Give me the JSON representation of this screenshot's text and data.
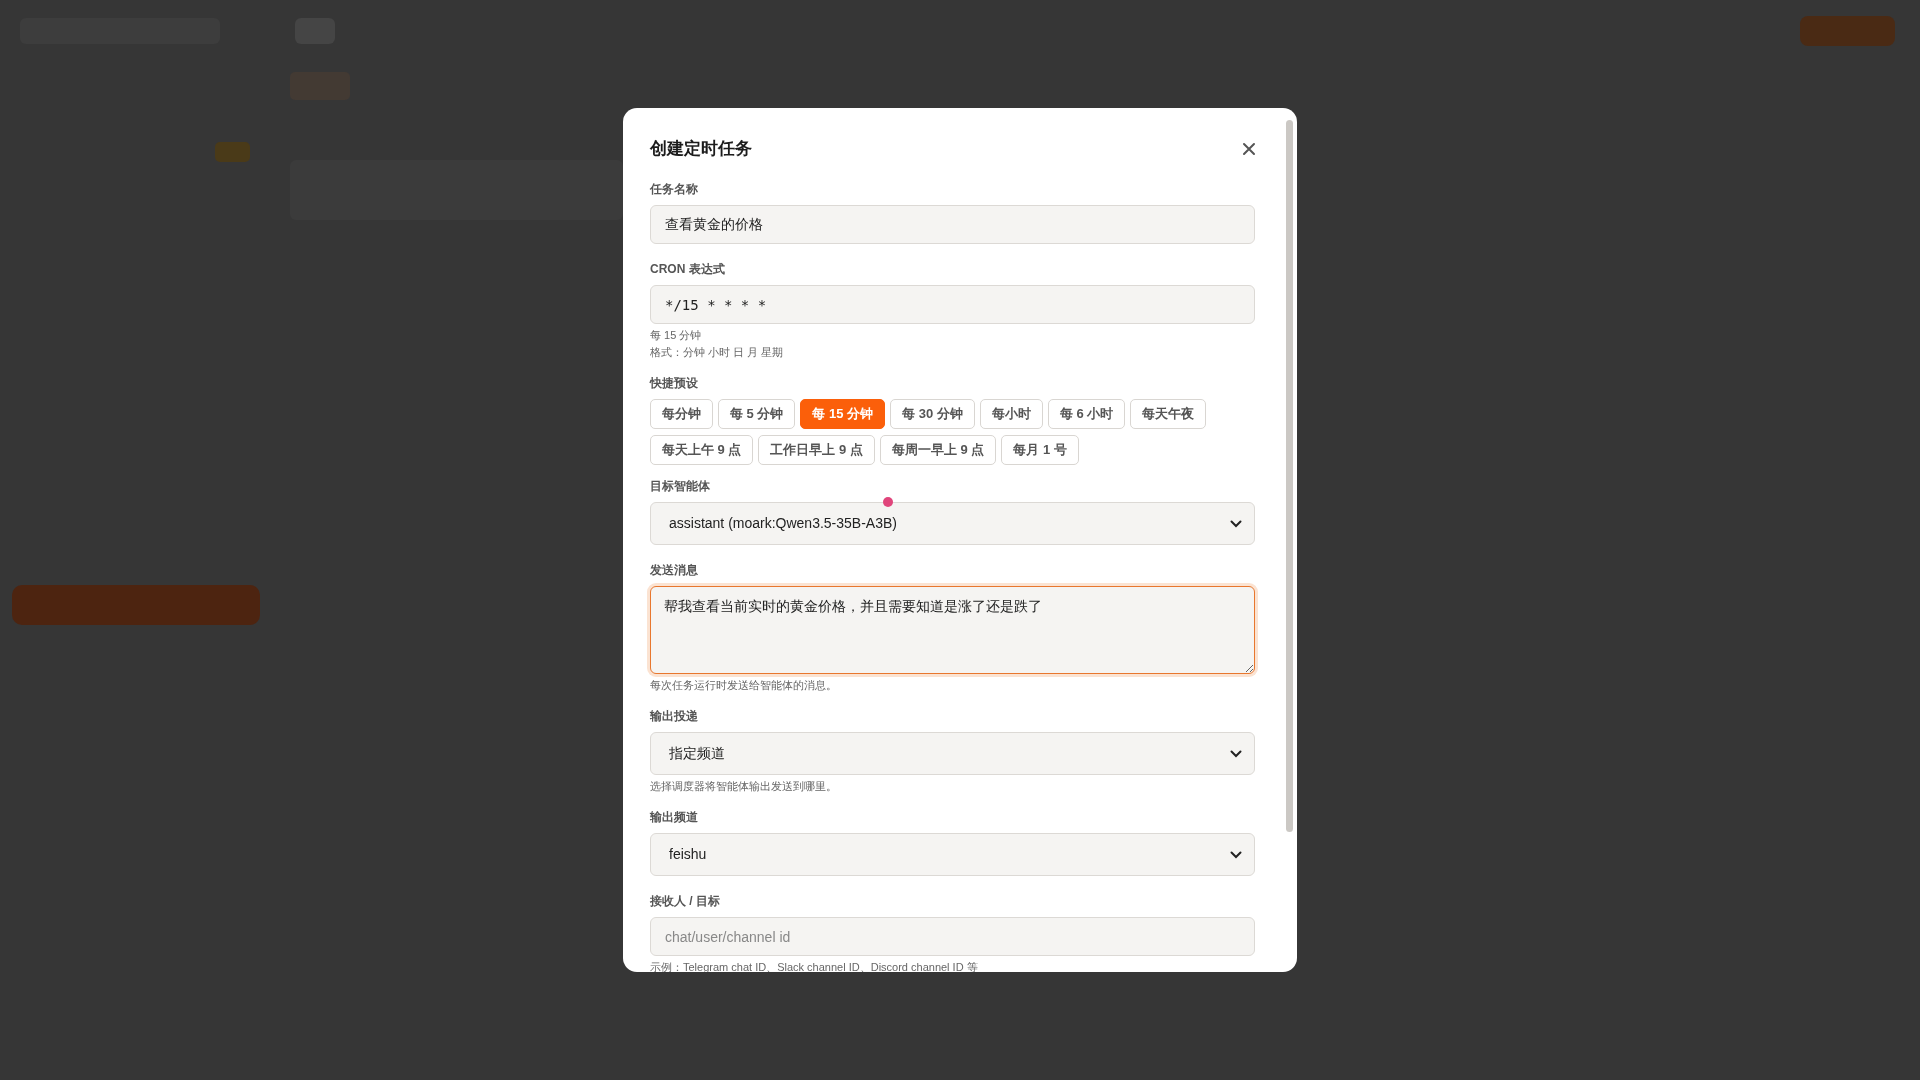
{
  "dialog": {
    "title": "创建定时任务"
  },
  "fields": [
    {
      "kind": "input",
      "label": "任务名称",
      "value": "查看黄金的价格",
      "focused": false
    },
    {
      "kind": "input",
      "label": "CRON 表达式",
      "value": "*/15 * * * *",
      "mono": true,
      "focused": false,
      "hints": [
        "每 15 分钟",
        "格式：分钟 小时 日 月 星期"
      ]
    },
    {
      "kind": "presets",
      "label": "快捷预设",
      "items": [
        {
          "label": "每分钟",
          "selected": false
        },
        {
          "label": "每 5 分钟",
          "selected": false
        },
        {
          "label": "每 15 分钟",
          "selected": true
        },
        {
          "label": "每 30 分钟",
          "selected": false
        },
        {
          "label": "每小时",
          "selected": false
        },
        {
          "label": "每 6 小时",
          "selected": false
        },
        {
          "label": "每天午夜",
          "selected": false
        },
        {
          "label": "每天上午 9 点",
          "selected": false
        },
        {
          "label": "工作日早上 9 点",
          "selected": false
        },
        {
          "label": "每周一早上 9 点",
          "selected": false
        },
        {
          "label": "每月 1 号",
          "selected": false
        }
      ]
    },
    {
      "kind": "select",
      "label": "目标智能体",
      "value": "assistant (moark:Qwen3.5-35B-A3B)",
      "focused": false
    },
    {
      "kind": "textarea",
      "label": "发送消息",
      "value": "帮我查看当前实时的黄金价格，并且需要知道是涨了还是跌了",
      "focused": true,
      "hints": [
        "每次任务运行时发送给智能体的消息。"
      ]
    },
    {
      "kind": "select",
      "label": "输出投递",
      "value": "指定频道",
      "focused": false,
      "hints": [
        "选择调度器将智能体输出发送到哪里。"
      ]
    },
    {
      "kind": "select",
      "label": "输出频道",
      "value": "feishu",
      "focused": false
    },
    {
      "kind": "input",
      "label": "接收人 / 目标",
      "placeholder": "chat/user/channel id",
      "focused": false,
      "hints": [
        "示例：Telegram chat ID、Slack channel ID、Discord channel ID 等"
      ]
    }
  ]
}
